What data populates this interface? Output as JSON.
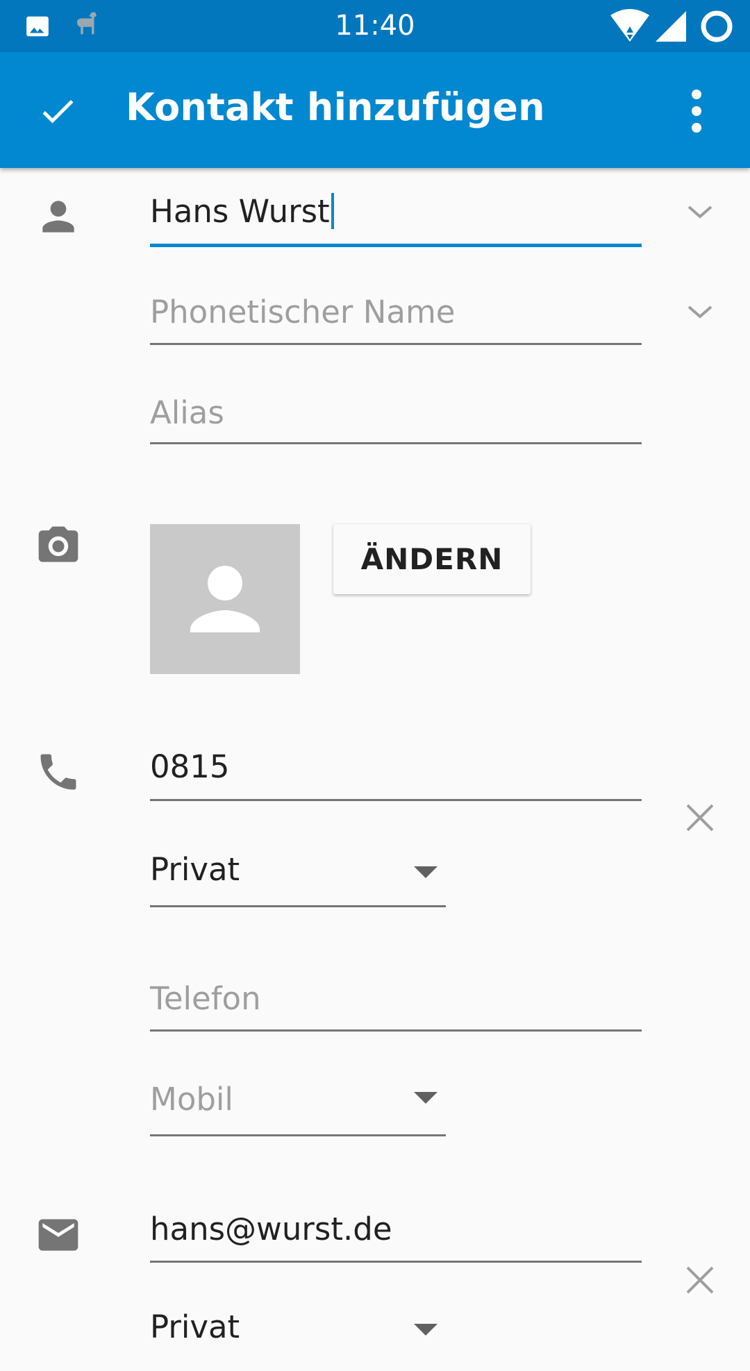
{
  "status_bar": {
    "time": "11:40",
    "left_icons": [
      "image-icon",
      "llama-icon"
    ],
    "right_icons": [
      "wifi-icon",
      "signal-icon",
      "sync-ring-icon"
    ]
  },
  "app_bar": {
    "title": "Kontakt hinzufügen",
    "confirm_icon": "check-icon",
    "menu_icon": "overflow-menu-icon",
    "color": "#0288d1",
    "status_color": "#0277bd"
  },
  "name_section": {
    "name_value": "Hans Wurst",
    "phonetic_placeholder": "Phonetischer Name",
    "alias_placeholder": "Alias"
  },
  "photo_section": {
    "change_label": "ÄNDERN"
  },
  "phone_section": {
    "phone_value": "0815",
    "phone_type": "Privat",
    "new_phone_placeholder": "Telefon",
    "new_phone_type_placeholder": "Mobil"
  },
  "email_section": {
    "email_value": "hans@wurst.de",
    "email_type": "Privat"
  },
  "accent_color": "#0288d1"
}
